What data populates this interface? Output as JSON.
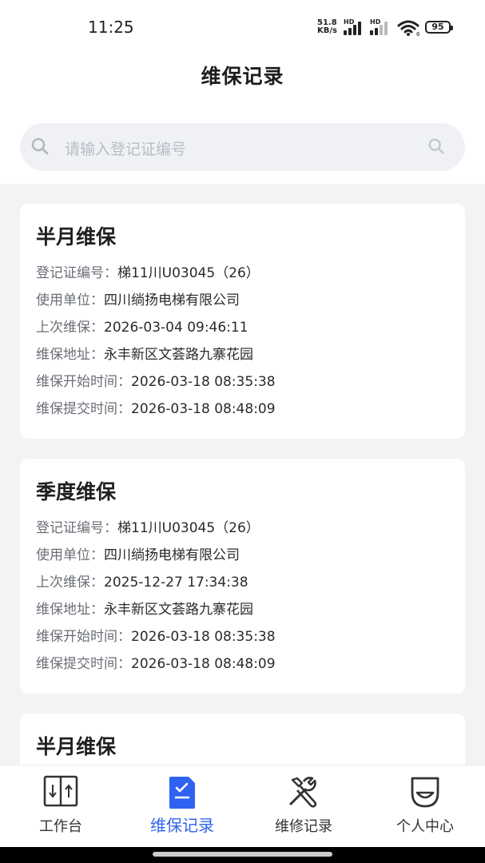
{
  "status_bar": {
    "time": "11:25",
    "net_speed_value": "51.8",
    "net_speed_unit": "KB/s",
    "hd1": "HD",
    "hd2": "HD",
    "wifi_badge": "6",
    "battery": "95"
  },
  "header": {
    "title": "维保记录"
  },
  "search": {
    "placeholder": "请输入登记证编号"
  },
  "records": [
    {
      "type": "半月维保",
      "fields": [
        {
          "label": "登记证编号：",
          "value": "梯11川U03045（26）"
        },
        {
          "label": "使用单位：",
          "value": "四川绱扬电梯有限公司"
        },
        {
          "label": "上次维保：",
          "value": "2026-03-04 09:46:11"
        },
        {
          "label": "维保地址：",
          "value": "永丰新区文荟路九寨花园"
        },
        {
          "label": "维保开始时间：",
          "value": "2026-03-18 08:35:38"
        },
        {
          "label": "维保提交时间：",
          "value": "2026-03-18 08:48:09"
        }
      ]
    },
    {
      "type": "季度维保",
      "fields": [
        {
          "label": "登记证编号：",
          "value": "梯11川U03045（26）"
        },
        {
          "label": "使用单位：",
          "value": "四川绱扬电梯有限公司"
        },
        {
          "label": "上次维保：",
          "value": "2025-12-27 17:34:38"
        },
        {
          "label": "维保地址：",
          "value": "永丰新区文荟路九寨花园"
        },
        {
          "label": "维保开始时间：",
          "value": "2026-03-18 08:35:38"
        },
        {
          "label": "维保提交时间：",
          "value": "2026-03-18 08:48:09"
        }
      ]
    },
    {
      "type": "半月维保",
      "fields": []
    }
  ],
  "tabbar": {
    "items": [
      {
        "label": "工作台",
        "icon": "elevator-icon",
        "active": false
      },
      {
        "label": "维保记录",
        "icon": "checklist-icon",
        "active": true
      },
      {
        "label": "维修记录",
        "icon": "tools-icon",
        "active": false
      },
      {
        "label": "个人中心",
        "icon": "profile-icon",
        "active": false
      }
    ]
  },
  "colors": {
    "accent": "#2f62f0",
    "background": "#f2f3f5",
    "card": "#ffffff"
  }
}
